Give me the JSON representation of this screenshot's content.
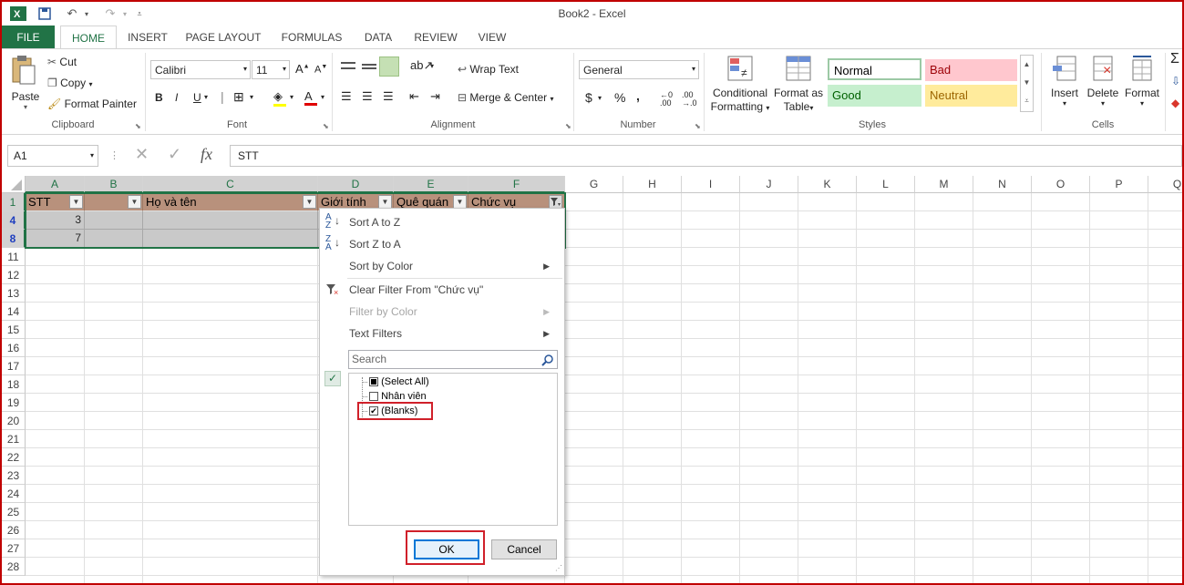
{
  "window": {
    "title": "Book2 - Excel"
  },
  "tabs": [
    "FILE",
    "HOME",
    "INSERT",
    "PAGE LAYOUT",
    "FORMULAS",
    "DATA",
    "REVIEW",
    "VIEW"
  ],
  "clipboard": {
    "paste": "Paste",
    "cut": "Cut",
    "copy": "Copy",
    "format_painter": "Format Painter",
    "label": "Clipboard"
  },
  "font": {
    "name": "Calibri",
    "size": "11",
    "label": "Font"
  },
  "alignment": {
    "wrap": "Wrap Text",
    "merge": "Merge & Center",
    "label": "Alignment"
  },
  "number": {
    "format": "General",
    "label": "Number"
  },
  "styles": {
    "conditional_1": "Conditional",
    "conditional_2": "Formatting",
    "format_as_1": "Format as",
    "format_as_2": "Table",
    "normal": "Normal",
    "bad": "Bad",
    "good": "Good",
    "neutral": "Neutral",
    "label": "Styles"
  },
  "cells": {
    "insert": "Insert",
    "delete": "Delete",
    "format": "Format",
    "label": "Cells"
  },
  "formula_bar": {
    "name_box": "A1",
    "fx": "fx",
    "content": "STT"
  },
  "columns": [
    "A",
    "B",
    "C",
    "D",
    "E",
    "F",
    "G",
    "H",
    "I",
    "J",
    "K",
    "L",
    "M",
    "N",
    "O",
    "P",
    "Q"
  ],
  "rows": [
    "1",
    "4",
    "8",
    "11",
    "12",
    "13",
    "14",
    "15",
    "16",
    "17",
    "18",
    "19",
    "20",
    "21",
    "22",
    "23",
    "24",
    "25",
    "26",
    "27",
    "28"
  ],
  "header_row": {
    "a": "STT",
    "b": "",
    "c": "Họ và tên",
    "d": "Giới tính",
    "e": "Quê quán",
    "f": "Chức vụ"
  },
  "data_rows": [
    {
      "a": "3"
    },
    {
      "a": "7"
    }
  ],
  "filter_menu": {
    "sort_az": "Sort A to Z",
    "sort_za": "Sort Z to A",
    "sort_color": "Sort by Color",
    "clear_filter": "Clear Filter From \"Chức vụ\"",
    "filter_color": "Filter by Color",
    "text_filters": "Text Filters",
    "search_placeholder": "Search",
    "items": [
      {
        "label": "(Select All)",
        "state": "mixed"
      },
      {
        "label": "Nhân viên",
        "state": "unchecked"
      },
      {
        "label": "(Blanks)",
        "state": "checked"
      }
    ],
    "ok": "OK",
    "cancel": "Cancel"
  },
  "colors": {
    "excel_green": "#217346",
    "header_fill": "#b8917c",
    "highlight_red": "#d0202a"
  }
}
